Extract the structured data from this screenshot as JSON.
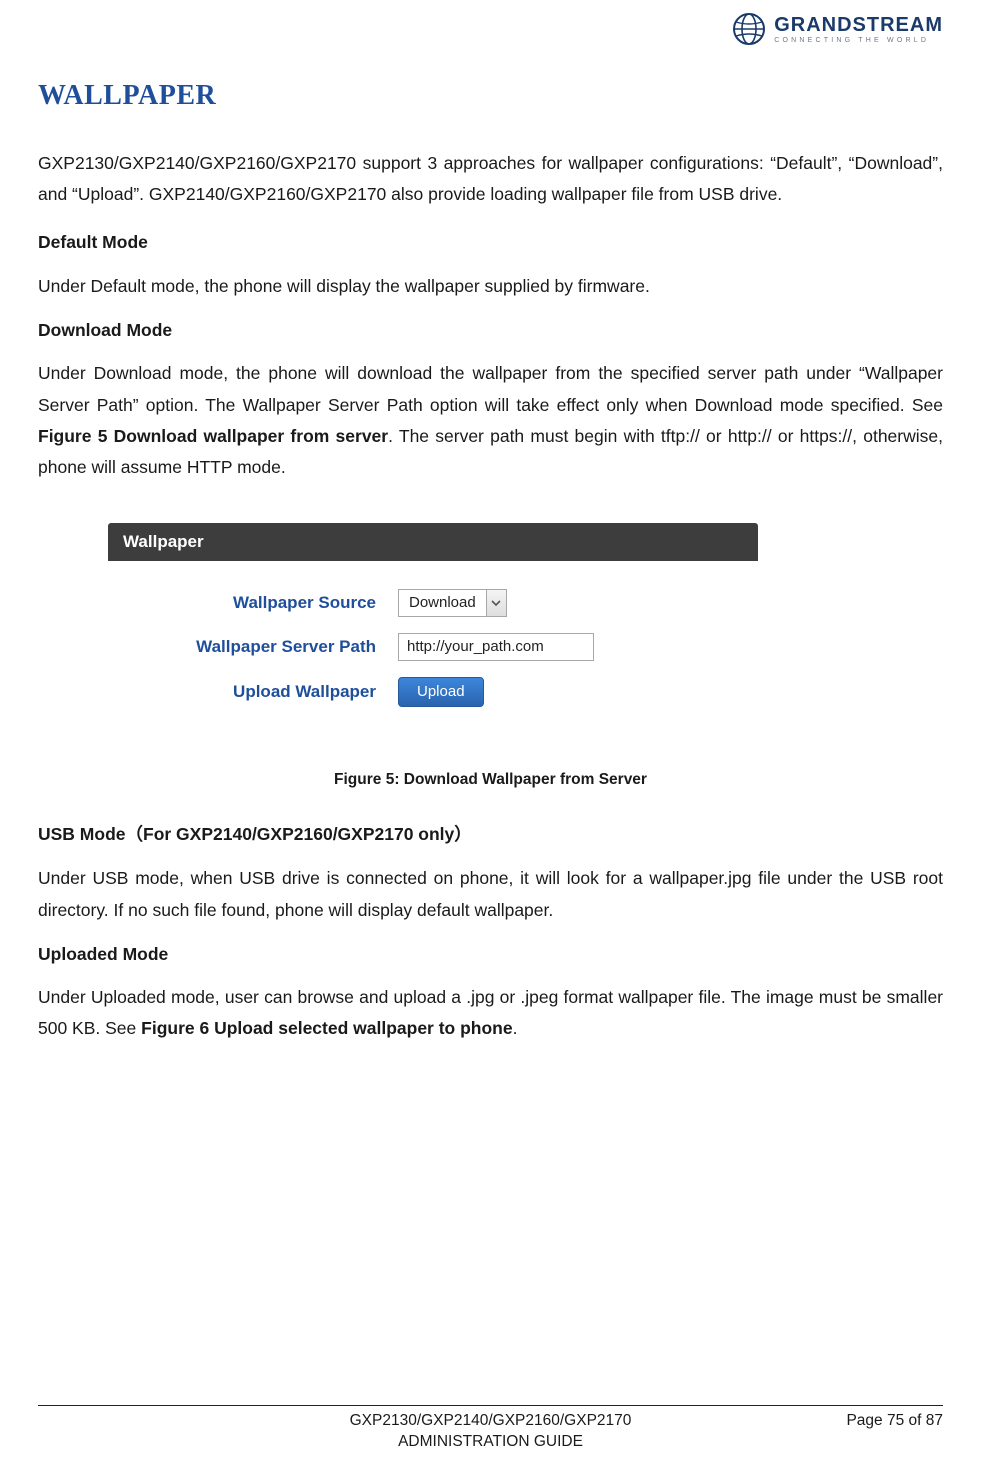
{
  "logo": {
    "brand": "GRANDSTREAM",
    "tagline": "CONNECTING THE WORLD"
  },
  "section_title": "WALLPAPER",
  "intro": "GXP2130/GXP2140/GXP2160/GXP2170 support 3 approaches for wallpaper configurations: “Default”, “Download”, and “Upload”. GXP2140/GXP2160/GXP2170 also provide loading wallpaper file from USB drive.",
  "sections": {
    "default": {
      "title": "Default Mode",
      "body": "Under Default mode, the phone will display the wallpaper supplied by firmware."
    },
    "download": {
      "title": "Download Mode",
      "body_pre": "Under Download mode, the phone will download the wallpaper from the specified server path under “Wallpaper Server Path” option. The Wallpaper Server Path option will take effect only when Download mode specified. See ",
      "fig_ref": "Figure 5 Download wallpaper from server",
      "body_post": ". The server path must begin with tftp:// or http:// or https://, otherwise, phone will assume HTTP mode."
    },
    "usb": {
      "title": "USB Mode",
      "paren": "（For GXP2140/GXP2160/GXP2170 only）",
      "body": "Under USB mode, when USB drive is connected on phone, it will look for a wallpaper.jpg file under the USB root directory. If no such file found, phone will display default wallpaper."
    },
    "uploaded": {
      "title": "Uploaded Mode",
      "body_pre": "Under Uploaded mode, user can browse and upload a .jpg or .jpeg format wallpaper file. The image must be smaller 500 KB. See ",
      "fig_ref": "Figure 6 Upload selected wallpaper to phone",
      "body_post": "."
    }
  },
  "figure": {
    "panel_title": "Wallpaper",
    "rows": {
      "source": {
        "label": "Wallpaper Source",
        "value": "Download"
      },
      "path": {
        "label": "Wallpaper Server Path",
        "value": "http://your_path.com"
      },
      "upload": {
        "label": "Upload Wallpaper",
        "button": "Upload"
      }
    },
    "caption": "Figure 5: Download Wallpaper from Server"
  },
  "footer": {
    "doc_line1": "GXP2130/GXP2140/GXP2160/GXP2170",
    "doc_line2": "ADMINISTRATION GUIDE",
    "page": "Page 75 of 87"
  }
}
